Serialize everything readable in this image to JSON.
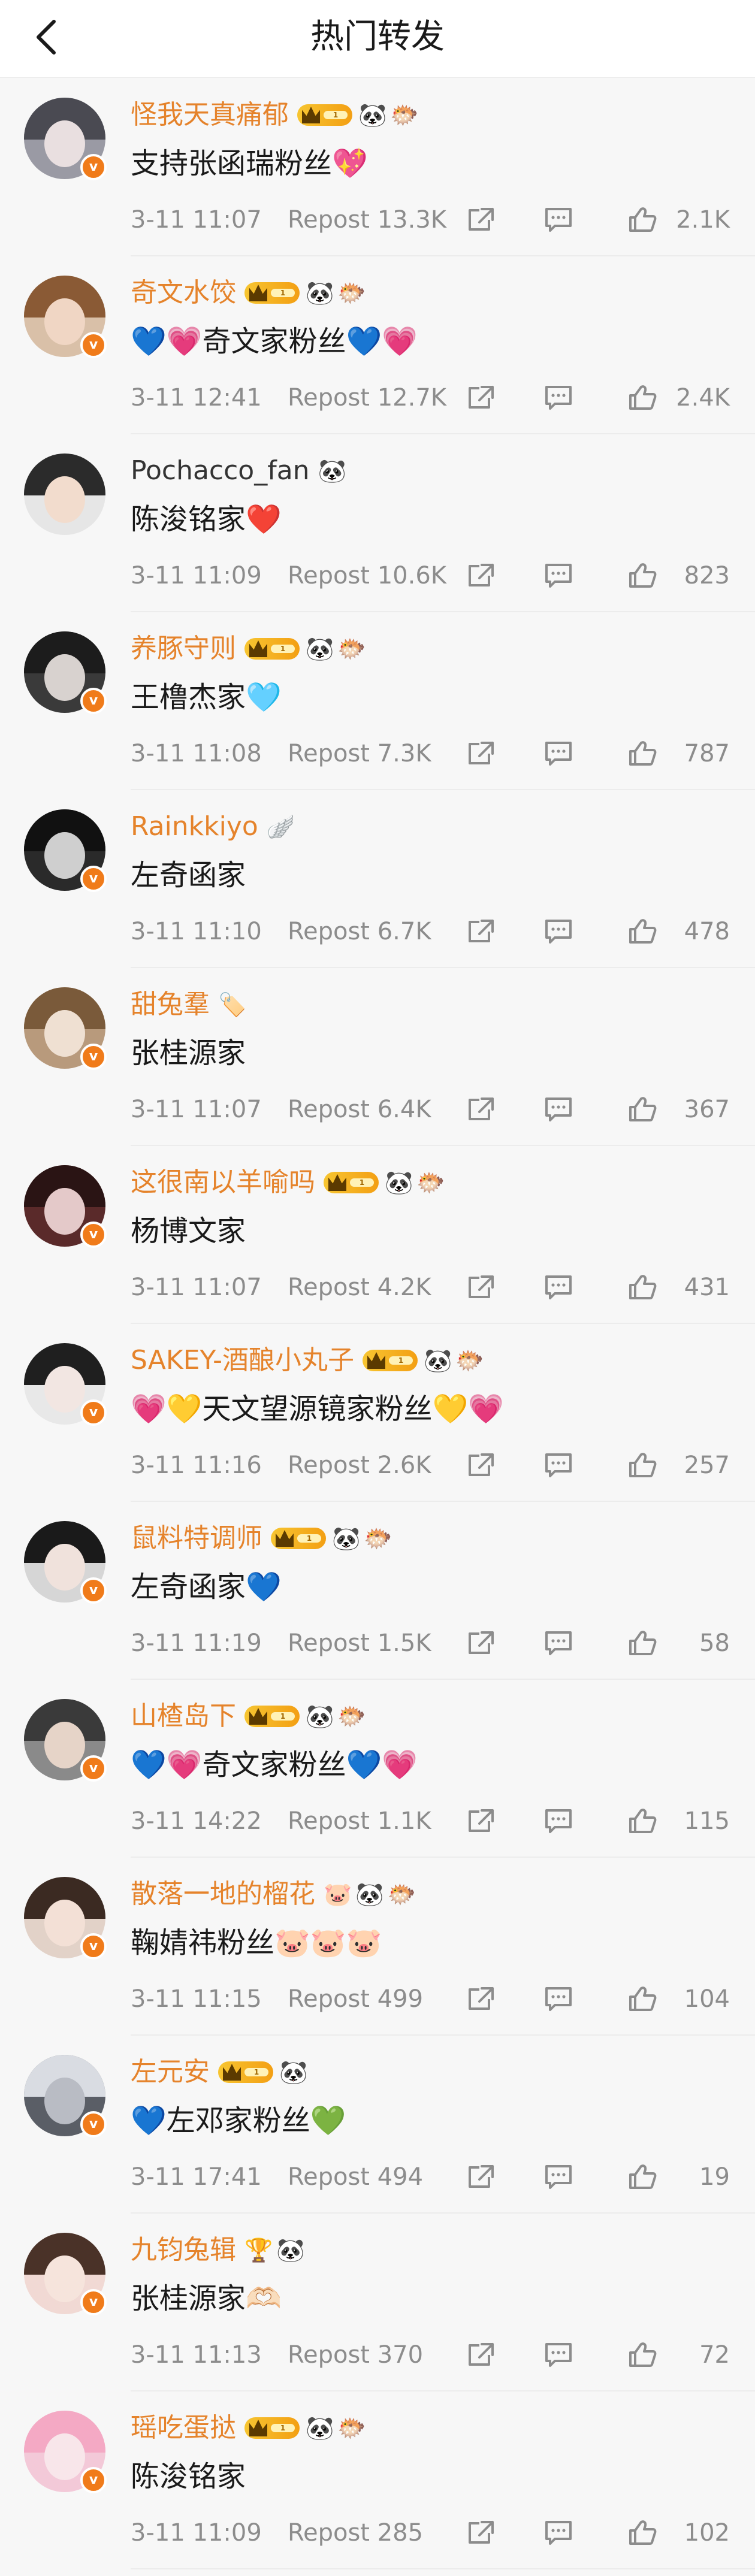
{
  "header": {
    "title": "热门转发"
  },
  "repost_label": "Repost",
  "items": [
    {
      "name": "怪我天真痛郁",
      "verified": true,
      "name_color": "orange",
      "level": "1",
      "emojis": [
        "🐼",
        "🐡"
      ],
      "text": "支持张函瑞粉丝💖",
      "time": "3-11 11:07",
      "reposts": "13.3K",
      "likes": "2.1K",
      "avatar_hair": "#4a4a52",
      "avatar_face": "#e9dfe0",
      "avatar_bg": "#9a9aa4"
    },
    {
      "name": "奇文水饺",
      "verified": true,
      "name_color": "orange",
      "level": "1",
      "emojis": [
        "🐼",
        "🐡"
      ],
      "text": "💙💗奇文家粉丝💙💗",
      "time": "3-11 12:41",
      "reposts": "12.7K",
      "likes": "2.4K",
      "avatar_hair": "#8a5a35",
      "avatar_face": "#f0d6c4",
      "avatar_bg": "#d9c0a8"
    },
    {
      "name": "Pochacco_fan",
      "verified": false,
      "name_color": "plain",
      "level": "",
      "emojis": [
        "🐼"
      ],
      "text": "陈浚铭家❤️",
      "time": "3-11 11:09",
      "reposts": "10.6K",
      "likes": "823",
      "avatar_hair": "#2b2b2b",
      "avatar_face": "#f2dccd",
      "avatar_bg": "#e6e6e6"
    },
    {
      "name": "养豚守则",
      "verified": true,
      "name_color": "orange",
      "level": "1",
      "emojis": [
        "🐼",
        "🐡"
      ],
      "text": "王橹杰家🩵",
      "time": "3-11 11:08",
      "reposts": "7.3K",
      "likes": "787",
      "avatar_hair": "#1c1c1c",
      "avatar_face": "#d8d2cf",
      "avatar_bg": "#3a3a3a"
    },
    {
      "name": "Rainkkiyo",
      "verified": true,
      "name_color": "orange",
      "level": "",
      "emojis": [
        "🪽"
      ],
      "text": "左奇函家",
      "time": "3-11 11:10",
      "reposts": "6.7K",
      "likes": "478",
      "avatar_hair": "#111111",
      "avatar_face": "#cfcfcf",
      "avatar_bg": "#2a2a2a"
    },
    {
      "name": "甜兔羣",
      "verified": true,
      "name_color": "orange",
      "level": "",
      "emojis": [
        "🏷️"
      ],
      "text": "张桂源家",
      "time": "3-11 11:07",
      "reposts": "6.4K",
      "likes": "367",
      "avatar_hair": "#7a5a3a",
      "avatar_face": "#efe0d2",
      "avatar_bg": "#b89a7c"
    },
    {
      "name": "这很南以羊喻吗",
      "verified": true,
      "name_color": "orange",
      "level": "1",
      "emojis": [
        "🐼",
        "🐡"
      ],
      "text": "杨博文家",
      "time": "3-11 11:07",
      "reposts": "4.2K",
      "likes": "431",
      "avatar_hair": "#2a1414",
      "avatar_face": "#e4c9c9",
      "avatar_bg": "#5a2a2a"
    },
    {
      "name": "SAKEY-酒酿小丸子",
      "verified": true,
      "name_color": "orange",
      "level": "1",
      "emojis": [
        "🐼",
        "🐡"
      ],
      "text": "💗💛天文望源镜家粉丝💛💗",
      "time": "3-11 11:16",
      "reposts": "2.6K",
      "likes": "257",
      "avatar_hair": "#1f1f1f",
      "avatar_face": "#f2e6e2",
      "avatar_bg": "#e8e8e8"
    },
    {
      "name": "鼠料特调师",
      "verified": true,
      "name_color": "orange",
      "level": "1",
      "emojis": [
        "🐼",
        "🐡"
      ],
      "text": "左奇函家💙",
      "time": "3-11 11:19",
      "reposts": "1.5K",
      "likes": "58",
      "avatar_hair": "#1a1a1a",
      "avatar_face": "#f0e2dc",
      "avatar_bg": "#d6d6d6"
    },
    {
      "name": "山楂岛下",
      "verified": true,
      "name_color": "orange",
      "level": "1",
      "emojis": [
        "🐼",
        "🐡"
      ],
      "text": "💙💗奇文家粉丝💙💗",
      "time": "3-11 14:22",
      "reposts": "1.1K",
      "likes": "115",
      "avatar_hair": "#3a3a3a",
      "avatar_face": "#e6d4c8",
      "avatar_bg": "#8a8a8a"
    },
    {
      "name": "散落一地的榴花",
      "verified": true,
      "name_color": "orange",
      "level": "",
      "emojis": [
        "🐷",
        "🐼",
        "🐡"
      ],
      "text": "鞠婧祎粉丝🐷🐷🐷",
      "time": "3-11 11:15",
      "reposts": "499",
      "likes": "104",
      "avatar_hair": "#3b2a22",
      "avatar_face": "#f3e0d6",
      "avatar_bg": "#e2d2c8"
    },
    {
      "name": "左元安",
      "verified": true,
      "name_color": "orange",
      "level": "1",
      "emojis": [
        "🐼"
      ],
      "text": "💙左邓家粉丝💚",
      "time": "3-11 17:41",
      "reposts": "494",
      "likes": "19",
      "avatar_hair": "#d9dce2",
      "avatar_face": "#b9bcc4",
      "avatar_bg": "#5a5e66"
    },
    {
      "name": "九钧兔辑",
      "verified": true,
      "name_color": "orange",
      "level": "",
      "emojis": [
        "🏆",
        "🐼"
      ],
      "text": "张桂源家🫶🏻",
      "time": "3-11 11:13",
      "reposts": "370",
      "likes": "72",
      "avatar_hair": "#4a3228",
      "avatar_face": "#f6e4dc",
      "avatar_bg": "#f1d9d4"
    },
    {
      "name": "瑶吃蛋挞",
      "verified": true,
      "name_color": "orange",
      "level": "1",
      "emojis": [
        "🐼",
        "🐡"
      ],
      "text": "陈浚铭家",
      "time": "3-11 11:09",
      "reposts": "285",
      "likes": "102",
      "avatar_hair": "#f4a9c4",
      "avatar_face": "#f8e6ea",
      "avatar_bg": "#f3c9d8"
    }
  ]
}
